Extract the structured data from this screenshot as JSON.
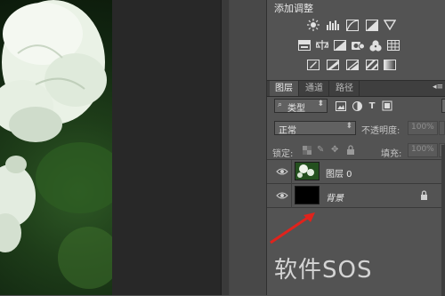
{
  "adjustments": {
    "title": "添加调整",
    "row1": [
      "brightness-sun-icon",
      "levels-icon",
      "curves-icon",
      "exposure-icon",
      "vibrance-triangle-icon"
    ],
    "row2": [
      "hue-saturation-icon",
      "color-balance-icon",
      "black-white-icon",
      "photo-filter-icon",
      "channel-mixer-icon",
      "color-lookup-icon"
    ],
    "row3": [
      "invert-icon",
      "posterize-icon",
      "threshold-icon",
      "selective-color-icon",
      "gradient-map-icon"
    ]
  },
  "layers_panel": {
    "tabs": [
      {
        "label": "图层",
        "active": true
      },
      {
        "label": "通道",
        "active": false
      },
      {
        "label": "路径",
        "active": false
      }
    ],
    "filter_label": "类型",
    "filter_icons": [
      "image-filter-icon",
      "adjustment-filter-icon",
      "type-filter-icon",
      "shape-filter-icon"
    ],
    "blend_mode": "正常",
    "opacity_label": "不透明度:",
    "opacity_value": "100%",
    "lock_label": "锁定:",
    "fill_label": "填充:",
    "fill_value": "100%",
    "layers": [
      {
        "name": "图层 0",
        "thumb": "flowers",
        "visible": true,
        "selected": false
      },
      {
        "name": "背景",
        "thumb": "black",
        "visible": true,
        "locked": true
      }
    ]
  },
  "watermark": {
    "text": "软件SOS"
  },
  "colors": {
    "panel": "#535353",
    "annotation_arrow": "#e0231c"
  }
}
